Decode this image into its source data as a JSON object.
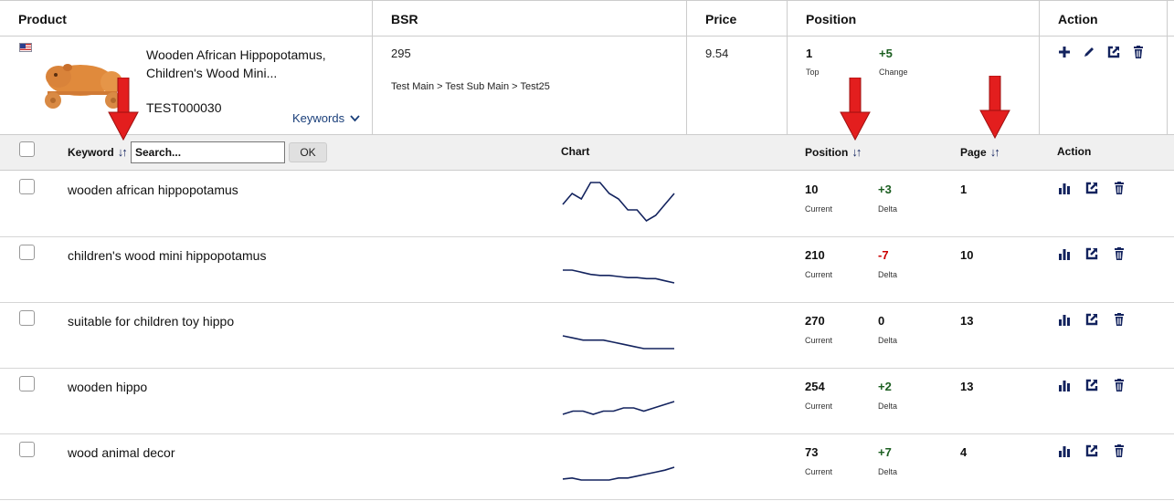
{
  "headers": {
    "product": "Product",
    "bsr": "BSR",
    "price": "Price",
    "position": "Position",
    "action": "Action"
  },
  "product": {
    "title": "Wooden African Hippopotamus, Children's Wood Mini...",
    "sku": "TEST000030",
    "keywords_link": "Keywords",
    "bsr": "295",
    "category_path": "Test Main > Test Sub Main > Test25",
    "price": "9.54",
    "top": "1",
    "top_label": "Top",
    "change": "+5",
    "change_label": "Change",
    "flag_icon": "us-flag-icon",
    "actions": [
      "plus-icon",
      "pencil-icon",
      "external-link-icon",
      "trash-icon"
    ]
  },
  "keyword_table": {
    "keyword_label": "Keyword",
    "search_placeholder": "Search...",
    "ok_label": "OK",
    "chart_label": "Chart",
    "position_label": "Position",
    "page_label": "Page",
    "action_label": "Action",
    "current_label": "Current",
    "delta_label": "Delta",
    "rows": [
      {
        "keyword": "wooden african hippopotamus",
        "current": "10",
        "delta": "+3",
        "delta_kind": "pos",
        "page": "1",
        "trend": [
          14,
          12,
          13,
          10,
          10,
          12,
          13,
          15,
          15,
          17,
          16,
          14,
          12
        ]
      },
      {
        "keyword": "children's wood mini hippopotamus",
        "current": "210",
        "delta": "-7",
        "delta_kind": "neg",
        "page": "10",
        "trend": [
          198,
          198,
          200,
          202,
          203,
          203,
          204,
          205,
          205,
          206,
          206,
          208,
          210
        ]
      },
      {
        "keyword": "suitable for children toy hippo",
        "current": "270",
        "delta": "0",
        "delta_kind": "neutral",
        "page": "13",
        "trend": [
          264,
          265,
          266,
          266,
          266,
          267,
          268,
          269,
          270,
          270,
          270,
          270
        ]
      },
      {
        "keyword": "wooden hippo",
        "current": "254",
        "delta": "+2",
        "delta_kind": "pos",
        "page": "13",
        "trend": [
          258,
          257,
          257,
          258,
          257,
          257,
          256,
          256,
          257,
          256,
          255,
          254
        ]
      },
      {
        "keyword": "wood animal decor",
        "current": "73",
        "delta": "+7",
        "delta_kind": "pos",
        "page": "4",
        "trend": [
          85,
          84,
          86,
          86,
          86,
          86,
          84,
          84,
          82,
          80,
          78,
          76,
          73
        ]
      }
    ],
    "row_actions": [
      "bar-chart-icon",
      "external-link-icon",
      "trash-icon"
    ]
  },
  "annotation_color": "#e31e1e",
  "accent_color": "#13235e"
}
